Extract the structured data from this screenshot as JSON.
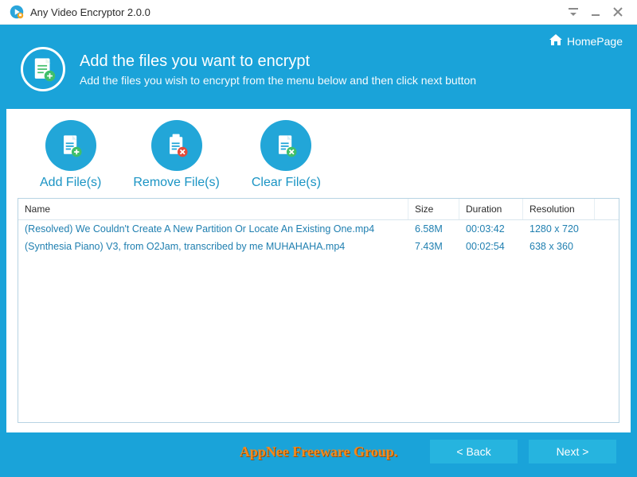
{
  "app": {
    "title": "Any Video Encryptor 2.0.0"
  },
  "header": {
    "homepage": "HomePage"
  },
  "hero": {
    "title": "Add the files you want to encrypt",
    "subtitle": "Add the files you wish to encrypt from the menu below and then click next button"
  },
  "actions": {
    "add": "Add File(s)",
    "remove": "Remove File(s)",
    "clear": "Clear File(s)"
  },
  "table": {
    "headers": {
      "name": "Name",
      "size": "Size",
      "duration": "Duration",
      "resolution": "Resolution"
    },
    "rows": [
      {
        "name": "(Resolved) We Couldn't Create A New Partition Or Locate An Existing One.mp4",
        "size": "6.58M",
        "duration": "00:03:42",
        "resolution": "1280 x 720"
      },
      {
        "name": "(Synthesia Piano) V3, from O2Jam, transcribed by me MUHAHAHA.mp4",
        "size": "7.43M",
        "duration": "00:02:54",
        "resolution": "638 x 360"
      }
    ]
  },
  "footer": {
    "watermark": "AppNee Freeware Group.",
    "back": "< Back",
    "next": "Next >"
  }
}
